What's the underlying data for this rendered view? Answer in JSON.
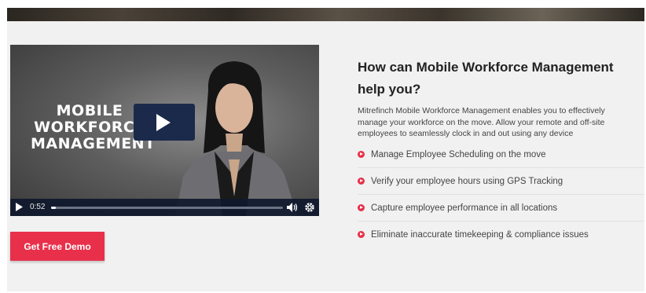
{
  "video": {
    "overlay_lines": [
      "MOBILE",
      "WORKFORCE",
      "MANAGEMENT"
    ],
    "time": "0:52",
    "progress_fraction": 0.02
  },
  "cta": {
    "label": "Get Free Demo"
  },
  "content": {
    "heading_line1": "How can Mobile Workforce Management",
    "heading_line2": "help you?",
    "description": [
      "Mitrefinch Mobile Workforce Management enables you to effectively",
      "manage your workforce on the move. Allow your remote and off-site",
      "employees to seamlessly clock in and out using any device"
    ],
    "features": [
      "Manage Employee Scheduling on the move",
      "Verify your employee hours using GPS Tracking",
      "Capture employee performance in all locations",
      "Eliminate inaccurate timekeeping & compliance issues"
    ]
  },
  "colors": {
    "accent": "#e8304a",
    "play_button": "#1b2a4a"
  }
}
